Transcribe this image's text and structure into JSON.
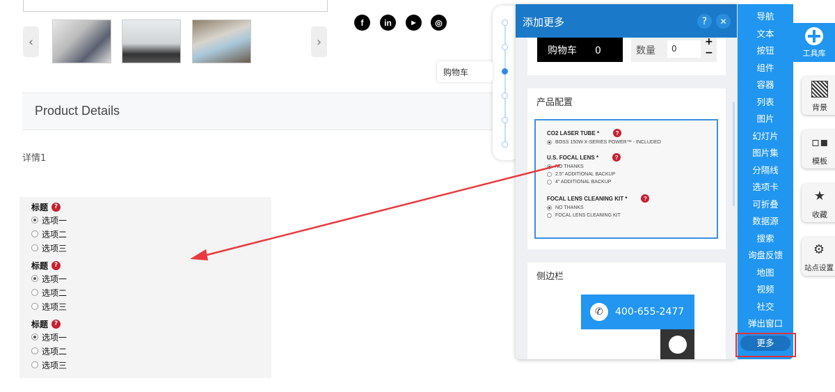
{
  "gallery": {
    "prev": "‹",
    "next": "›",
    "thumbnails": [
      "living-room-1",
      "living-room-2",
      "balcony"
    ]
  },
  "social": [
    {
      "name": "facebook",
      "glyph": "f"
    },
    {
      "name": "linkedin",
      "glyph": "in"
    },
    {
      "name": "youtube",
      "glyph": "▶"
    },
    {
      "name": "instagram",
      "glyph": "◎"
    }
  ],
  "product_details": {
    "title": "Product Details",
    "detail": "详情1"
  },
  "radio_groups": [
    {
      "title": "标题",
      "options": [
        "选项一",
        "选项二",
        "选项三"
      ],
      "selected": 0
    },
    {
      "title": "标题",
      "options": [
        "选项一",
        "选项二",
        "选项三"
      ],
      "selected": 0
    },
    {
      "title": "标题",
      "options": [
        "选项一",
        "选项二",
        "选项三"
      ],
      "selected": 0
    }
  ],
  "timeline": {
    "tooltip": "购物车"
  },
  "dialog": {
    "title": "添加更多",
    "help": "?",
    "close": "✕",
    "cart": {
      "label": "购物车",
      "count": "0",
      "qty_label": "数量",
      "qty_value": "0",
      "plus": "+",
      "minus": "−"
    },
    "config": {
      "title": "产品配置",
      "groups": [
        {
          "label": "CO2 LASER TUBE *",
          "options": [
            "BOSS 150W X-SERIES POWER™ - INCLUDED"
          ]
        },
        {
          "label": "U.S. FOCAL LENS *",
          "options": [
            "NO THANKS",
            "2.5\" ADDITIONAL BACKUP",
            "4\" ADDITIONAL BACKUP"
          ]
        },
        {
          "label": "FOCAL LENS CLEANING KIT *",
          "options": [
            "NO THANKS",
            "FOCAL LENS CLEANING KIT"
          ]
        }
      ]
    },
    "sidebar": {
      "title": "侧边栏",
      "phone": "400-655-2477"
    }
  },
  "nav": {
    "items": [
      "导航",
      "文本",
      "按钮",
      "组件",
      "容器",
      "列表",
      "图片",
      "幻灯片",
      "图片集",
      "分隔线",
      "选项卡",
      "可折叠",
      "数据源",
      "搜索",
      "询盘反馈",
      "地图",
      "视频",
      "社交",
      "弹出窗口"
    ],
    "more": "更多"
  },
  "side_tools": {
    "toolbox": "工具库",
    "background": "背景",
    "template": "模板",
    "favorites": "收藏",
    "site_settings": "站点设置"
  },
  "colors": {
    "primary": "#2196f0",
    "header": "#1b79c9",
    "annotation": "#e0323a"
  }
}
